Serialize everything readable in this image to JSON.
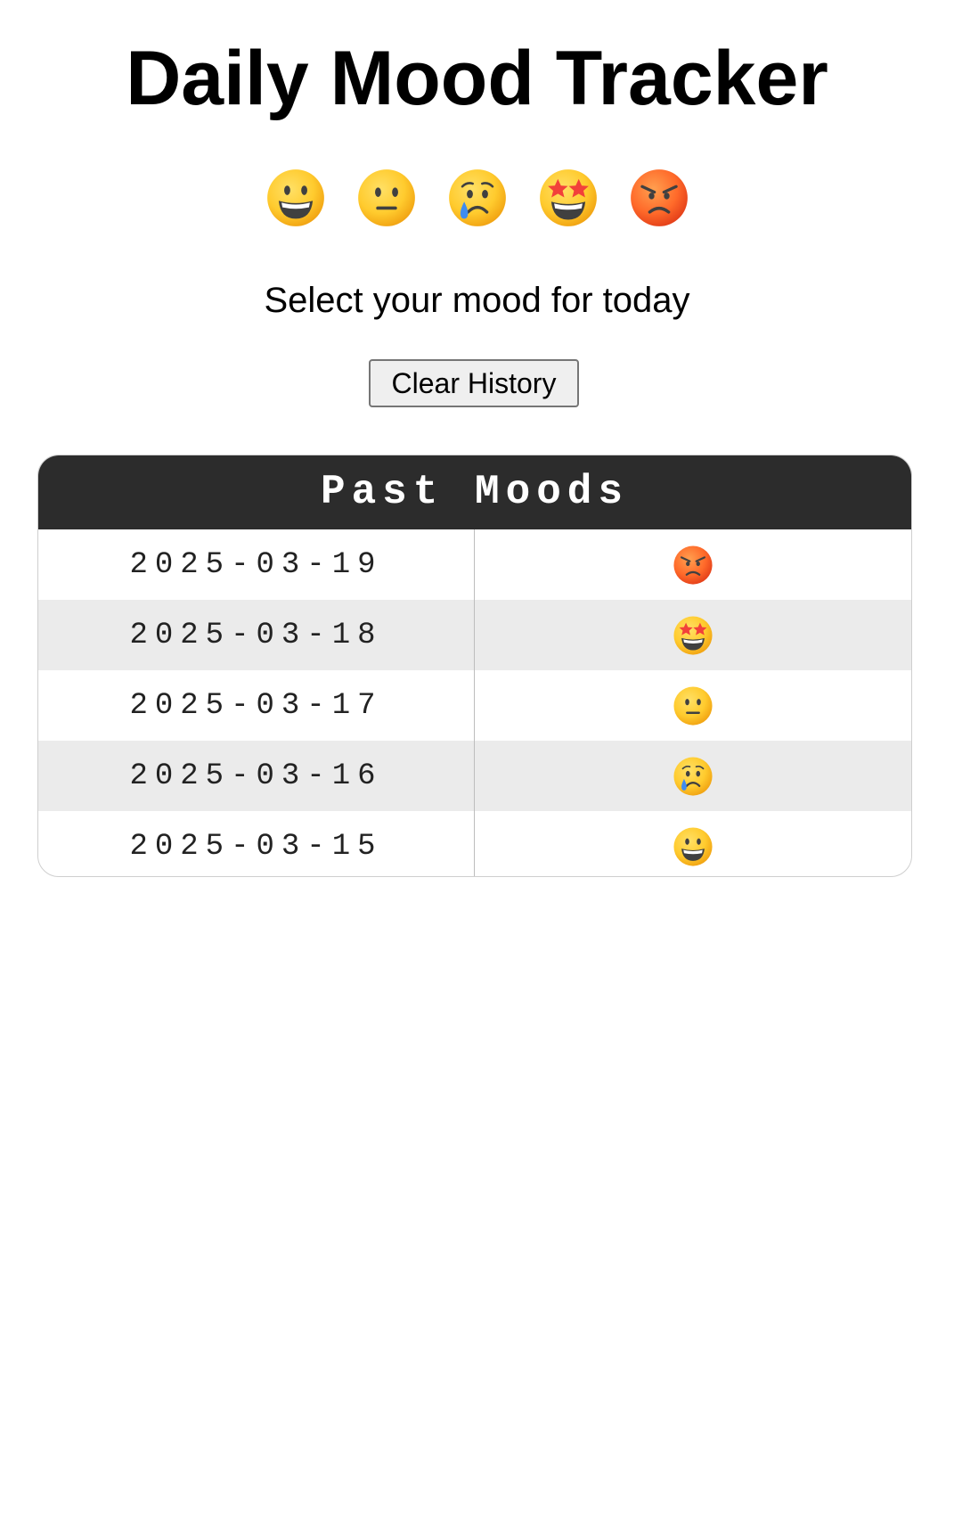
{
  "page": {
    "title": "Daily Mood Tracker",
    "prompt": "Select your mood for today",
    "clear_button_label": "Clear History"
  },
  "moods": [
    {
      "id": "happy",
      "icon": "grinning-face-icon",
      "emoji": "😀"
    },
    {
      "id": "neutral",
      "icon": "neutral-face-icon",
      "emoji": "😐"
    },
    {
      "id": "sad",
      "icon": "crying-face-icon",
      "emoji": "😢"
    },
    {
      "id": "excited",
      "icon": "star-struck-face-icon",
      "emoji": "🤩"
    },
    {
      "id": "angry",
      "icon": "angry-face-icon",
      "emoji": "😡"
    }
  ],
  "history": {
    "title": "Past Moods",
    "rows": [
      {
        "date": "2025-03-19",
        "mood": "angry"
      },
      {
        "date": "2025-03-18",
        "mood": "excited"
      },
      {
        "date": "2025-03-17",
        "mood": "neutral"
      },
      {
        "date": "2025-03-16",
        "mood": "sad"
      },
      {
        "date": "2025-03-15",
        "mood": "happy"
      }
    ]
  },
  "colors": {
    "header_bg": "#2c2c2c",
    "alt_row_bg": "#ebebeb",
    "face_yellow": "#ffcb2e",
    "face_red": "#ff6a2a"
  }
}
